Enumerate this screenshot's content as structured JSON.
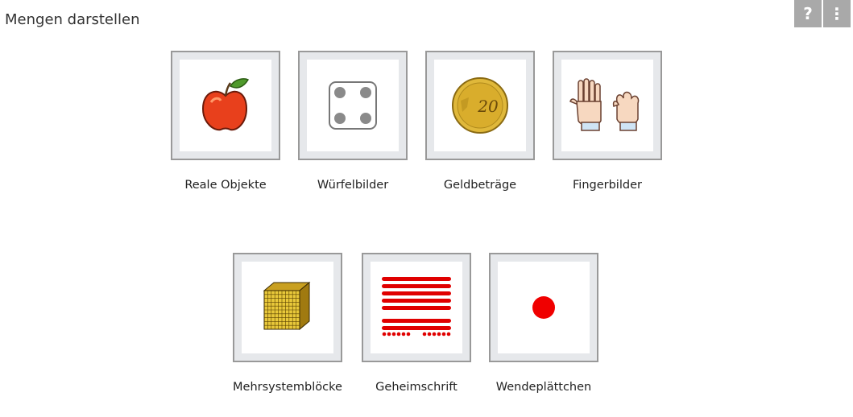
{
  "header": {
    "title": "Mengen darstellen"
  },
  "toolbar": {
    "help_label": "?",
    "menu_label": "⋮"
  },
  "tiles": [
    {
      "label": "Reale Objekte",
      "icon": "apple-icon"
    },
    {
      "label": "Würfelbilder",
      "icon": "dice-four-icon"
    },
    {
      "label": "Geldbeträge",
      "icon": "coin-20-cent-icon"
    },
    {
      "label": "Fingerbilder",
      "icon": "hands-fingers-icon"
    },
    {
      "label": "Mehrsystemblöcke",
      "icon": "base-ten-cube-icon"
    },
    {
      "label": "Geheimschrift",
      "icon": "secret-code-lines-icon"
    },
    {
      "label": "Wendeplättchen",
      "icon": "red-counter-icon"
    }
  ],
  "coin": {
    "text": "20"
  },
  "colors": {
    "tile_border": "#999999",
    "tile_frame": "#e6e8eb",
    "accent_red": "#e00000",
    "toolbar_gray": "#a9a9a9"
  }
}
